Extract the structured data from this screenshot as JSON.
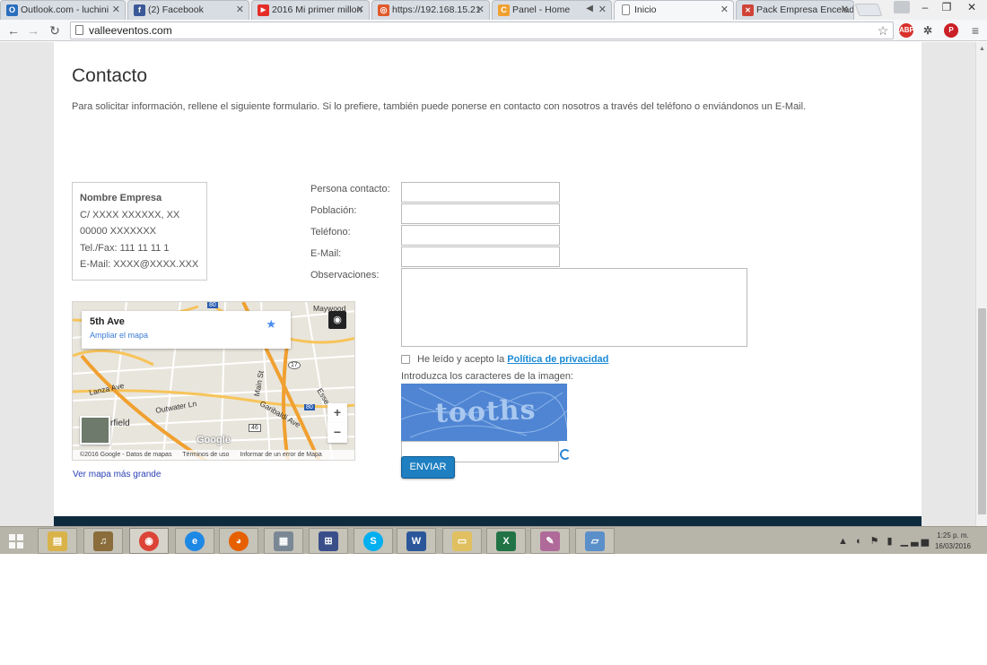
{
  "browser": {
    "tabs": [
      {
        "label": "Outlook.com - luchini",
        "favicon": "O",
        "color": "#2a6ebd"
      },
      {
        "label": "(2) Facebook",
        "favicon": "f",
        "color": "#3b5998"
      },
      {
        "label": "2016 Mi primer millon",
        "favicon": "▶",
        "color": "#e52d27"
      },
      {
        "label": "https://192.168.15.21",
        "favicon": "◎",
        "color": "#e15a2b"
      },
      {
        "label": "Panel - Home",
        "favicon": "C",
        "color": "#f0a030"
      },
      {
        "label": "Inicio",
        "favicon": "",
        "color": "#ffffff"
      },
      {
        "label": "Pack Empresa Encelad",
        "favicon": "✕",
        "color": "#d04437"
      }
    ],
    "url": "valleeventos.com",
    "win_min": "–",
    "win_max": "❐",
    "win_close": "✕",
    "abp": "ABP"
  },
  "page": {
    "title": "Contacto",
    "intro": "Para solicitar información, rellene el siguiente formulario. Si lo prefiere, también puede ponerse en contacto con nosotros  a través del teléfono o enviándonos un E-Mail.",
    "company": {
      "name": "Nombre Empresa",
      "address1": "C/ XXXX XXXXXX, XX",
      "address2": "00000 XXXXXXX",
      "phone": "Tel./Fax: 111 11 11 1",
      "email": "E-Mail: XXXX@XXXX.XXX"
    },
    "map": {
      "place": "5th Ave",
      "enlarge": "Ampliar el mapa",
      "label_maywood": "Maywood",
      "label_lanza": "Lanza Ave",
      "label_outwater": "Outwater Ln",
      "label_garibaldi": "Garibaldi Ave",
      "label_main": "Main St",
      "label_rfield": "rfield",
      "label_ess": "Esse",
      "route_17": "17",
      "route_80": "80",
      "route_46": "46",
      "route_80b": "80",
      "google": "Google",
      "zoom_in": "+",
      "zoom_out": "−",
      "footer_copy": "©2016 Google - Datos de mapas",
      "footer_terms": "Términos de uso",
      "footer_report": "Informar de un error de Mapa",
      "bigger_link": "Ver mapa más grande"
    },
    "form": {
      "label_contact": "Persona contacto:",
      "label_city": "Población:",
      "label_phone": "Teléfono:",
      "label_email": "E-Mail:",
      "label_notes": "Observaciones:",
      "privacy_prefix": "He leído y acepto la",
      "privacy_link": "Política de privacidad",
      "captcha_label": "Introduzca los caracteres de la imagen:",
      "captcha_word": "tooths",
      "send": "ENVIAR"
    }
  },
  "taskbar": {
    "clock_time": "1:25 p. m.",
    "clock_date": "16/03/2016",
    "apps": [
      {
        "name": "file-explorer",
        "glyph": "▤",
        "color": "#d9b24a"
      },
      {
        "name": "itunes",
        "glyph": "♫",
        "color": "#8a6d3b"
      },
      {
        "name": "chrome",
        "glyph": "◉",
        "color": "#db4437"
      },
      {
        "name": "internet-explorer",
        "glyph": "e",
        "color": "#1e88e5"
      },
      {
        "name": "firefox",
        "glyph": "◕",
        "color": "#e66000"
      },
      {
        "name": "calculator",
        "glyph": "▦",
        "color": "#7a8794"
      },
      {
        "name": "network",
        "glyph": "⊞",
        "color": "#3a4f8a"
      },
      {
        "name": "skype",
        "glyph": "S",
        "color": "#00aff0"
      },
      {
        "name": "word",
        "glyph": "W",
        "color": "#2b579a"
      },
      {
        "name": "folder",
        "glyph": "▭",
        "color": "#e0c060"
      },
      {
        "name": "excel",
        "glyph": "X",
        "color": "#217346"
      },
      {
        "name": "paint",
        "glyph": "✎",
        "color": "#b06a9a"
      },
      {
        "name": "notes",
        "glyph": "▱",
        "color": "#5a8fc9"
      }
    ],
    "tray_icons": "▲ ◐ ⚑ ▮ ▁▃▅"
  }
}
